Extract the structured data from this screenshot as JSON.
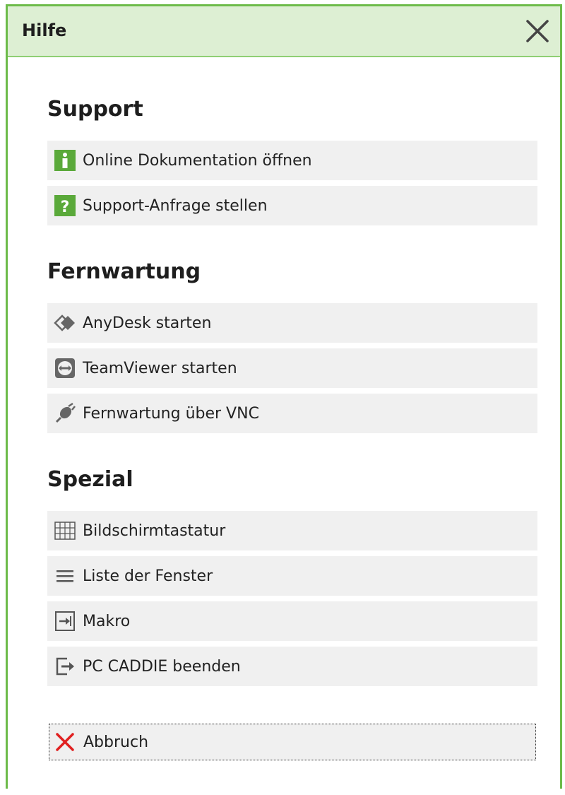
{
  "window": {
    "title": "Hilfe"
  },
  "sections": [
    {
      "heading": "Support",
      "items": [
        {
          "label": "Online Dokumentation öffnen",
          "icon": "info-icon"
        },
        {
          "label": "Support-Anfrage stellen",
          "icon": "question-icon"
        }
      ]
    },
    {
      "heading": "Fernwartung",
      "items": [
        {
          "label": "AnyDesk starten",
          "icon": "anydesk-icon"
        },
        {
          "label": "TeamViewer starten",
          "icon": "teamviewer-icon"
        },
        {
          "label": "Fernwartung über VNC",
          "icon": "vnc-plug-icon"
        }
      ]
    },
    {
      "heading": "Spezial",
      "items": [
        {
          "label": "Bildschirmtastatur",
          "icon": "keyboard-grid-icon"
        },
        {
          "label": "Liste der Fenster",
          "icon": "list-icon"
        },
        {
          "label": "Makro",
          "icon": "macro-arrow-icon"
        },
        {
          "label": "PC CADDIE beenden",
          "icon": "exit-icon"
        }
      ]
    }
  ],
  "cancel": {
    "label": "Abbruch",
    "icon": "red-x-icon"
  },
  "colors": {
    "accent_green": "#6dbb4a",
    "titlebar_bg": "#ddefd3",
    "item_bg": "#f0f0f0",
    "icon_green": "#5aa93a",
    "cancel_red": "#e02020"
  }
}
